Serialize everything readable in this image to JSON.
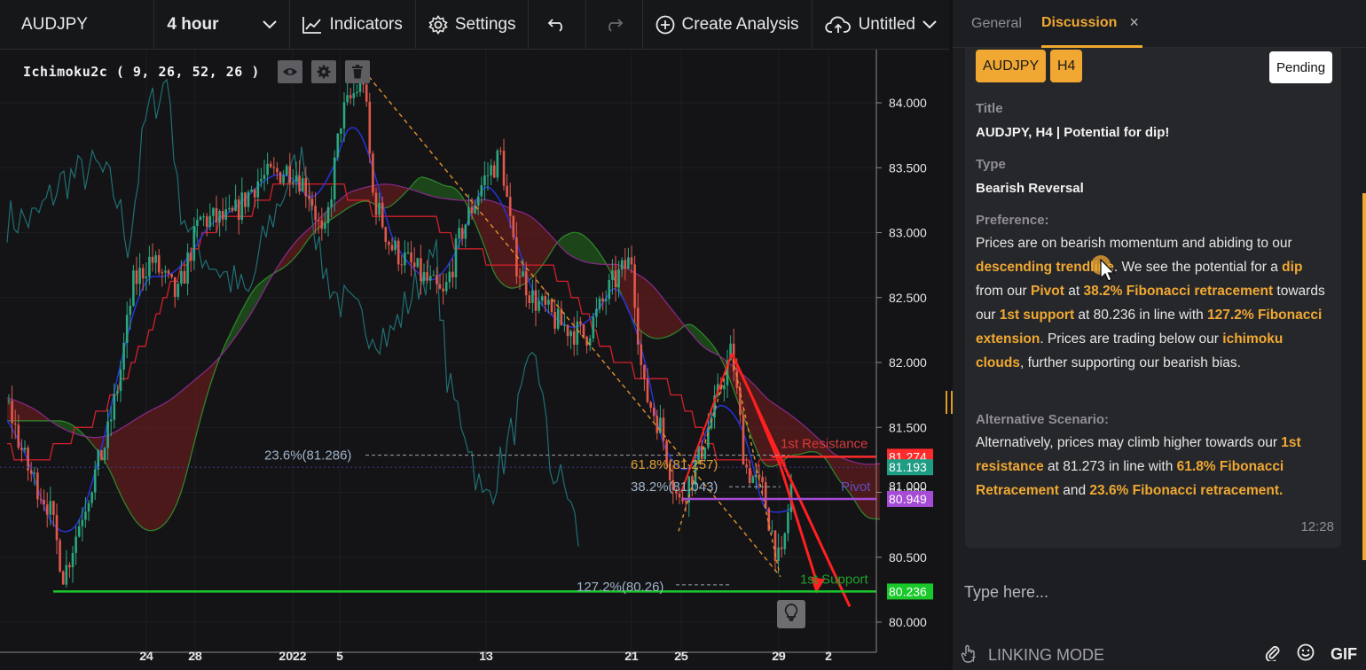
{
  "toolbar": {
    "symbol": "AUDJPY",
    "interval": "4 hour",
    "indicators_label": "Indicators",
    "settings_label": "Settings",
    "create_analysis_label": "Create Analysis",
    "layout_name": "Untitled"
  },
  "indicator": {
    "label": "Ichimoku2c ( 9, 26, 52, 26 )"
  },
  "chart_data": {
    "type": "candlestick",
    "symbol": "AUDJPY",
    "timeframe": "4 hour",
    "ylim": [
      79.95,
      84.25
    ],
    "y_ticks": [
      "84.000",
      "83.500",
      "83.000",
      "82.500",
      "82.000",
      "81.500",
      "81.000",
      "80.500",
      "80.000"
    ],
    "x_ticks": [
      "24",
      "28",
      "2022",
      "5",
      "13",
      "21",
      "25",
      "29",
      "2"
    ],
    "annotations": {
      "fib_236": "23.6%(81.286)",
      "fib_618": "61.8%(81.257)",
      "fib_382": "38.2%(81.043)",
      "fib_1272": "127.2%(80.26)",
      "resistance_label": "1st Resistance",
      "pivot_label": "Pivot",
      "support_label": "1st Support"
    },
    "levels": {
      "resistance": 81.274,
      "pivot": 80.949,
      "support": 80.236,
      "current": 81.193
    },
    "price_tags": [
      "81.274",
      "81.193",
      "81.000",
      "80.949",
      "80.236"
    ],
    "colors": {
      "resistance": "#ff2b2b",
      "pivot": "#a64bd6",
      "support": "#19c92a",
      "current": "#1f9d84",
      "candle_up": "#2aa77f",
      "candle_down": "#e0584d"
    }
  },
  "panel": {
    "tabs": [
      "General",
      "Discussion"
    ],
    "tags": [
      "AUDJPY",
      "H4"
    ],
    "status": "Pending",
    "title_label": "Title",
    "title_value": "AUDJPY, H4 | Potential for dip!",
    "type_label": "Type",
    "type_value": "Bearish Reversal",
    "preference_label": "Preference:",
    "preference": {
      "t1": "Prices are on bearish momentum and abiding to our ",
      "h1": "descending trendline",
      "t2": ". We see the potential for a ",
      "h2": "dip",
      "t3": " from our ",
      "h3": "Pivot",
      "t4": " at ",
      "h4": "38.2% Fibonacci retracement",
      "t5": " towards our ",
      "h5": "1st support",
      "t6": " at 80.236 in line with ",
      "h6": "127.2% Fibonacci extension",
      "t7": ".  Prices are trading below our ",
      "h7": "ichimoku clouds",
      "t8": ", further supporting our bearish bias."
    },
    "alt_label": "Alternative Scenario:",
    "alternative": {
      "t1": "Alternatively, prices may climb higher towards our ",
      "h1": "1st resistance",
      "t2": " at 81.273 in line with ",
      "h2": "61.8% Fibonacci Retracement",
      "t3": " and ",
      "h3": "23.6% Fibonacci retracement."
    },
    "time": "12:28",
    "input_placeholder": "Type here...",
    "linking_mode": "LINKING MODE",
    "gif_label": "GIF"
  }
}
